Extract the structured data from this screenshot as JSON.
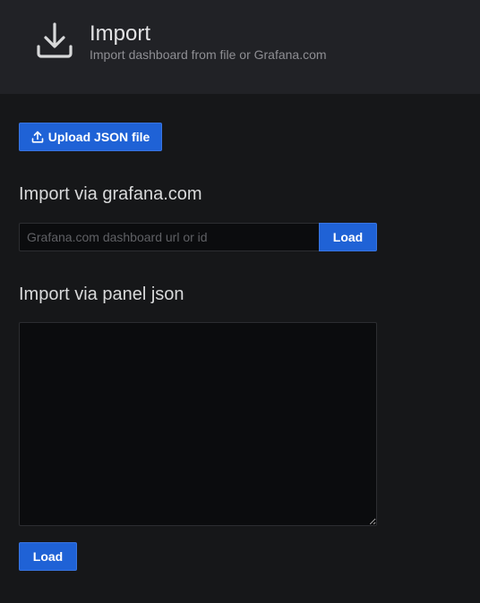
{
  "header": {
    "icon": "download-icon",
    "title": "Import",
    "subtitle": "Import dashboard from file or Grafana.com"
  },
  "upload": {
    "icon": "upload-icon",
    "label": "Upload JSON file"
  },
  "grafana_com": {
    "title": "Import via grafana.com",
    "input_value": "",
    "input_placeholder": "Grafana.com dashboard url or id",
    "load_label": "Load"
  },
  "panel_json": {
    "title": "Import via panel json",
    "textarea_value": "",
    "load_label": "Load"
  },
  "colors": {
    "page_background": "#161719",
    "header_background": "#212226",
    "primary_button": "#1f62d6",
    "input_background": "#0b0c0e"
  }
}
